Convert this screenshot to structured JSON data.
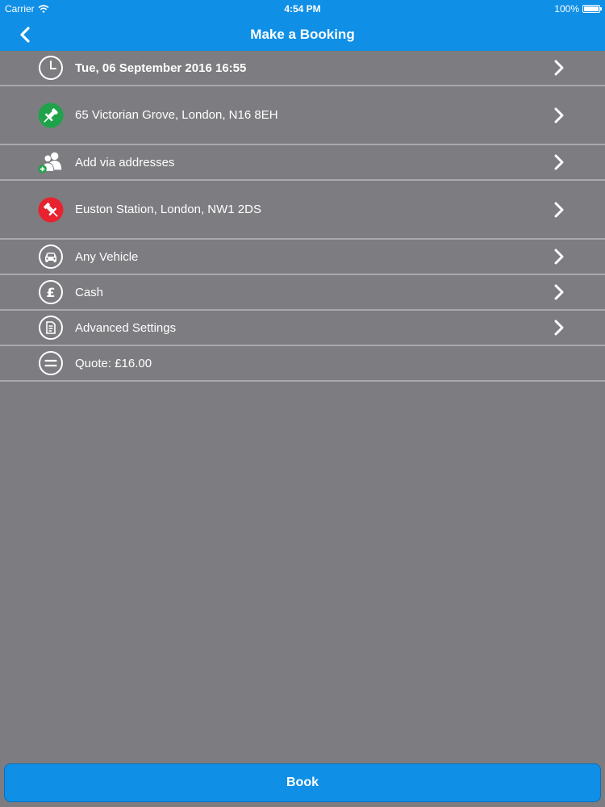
{
  "status_bar": {
    "carrier": "Carrier",
    "time": "4:54 PM",
    "battery": "100%"
  },
  "nav": {
    "title": "Make a Booking"
  },
  "rows": [
    {
      "label": "Tue, 06 September 2016 16:55",
      "icon": "clock-icon"
    },
    {
      "label": "65 Victorian Grove, London, N16 8EH",
      "icon": "pickup-pin-icon",
      "icon_color": "#1fa34a"
    },
    {
      "label": "Add via addresses",
      "icon": "add-people-icon",
      "icon_color": "#1fa34a"
    },
    {
      "label": "Euston Station, London, NW1 2DS",
      "icon": "dropoff-pin-icon",
      "icon_color": "#e8232f"
    },
    {
      "label": "Any Vehicle",
      "icon": "car-icon"
    },
    {
      "label": "Cash",
      "icon": "pound-icon"
    },
    {
      "label": "Advanced Settings",
      "icon": "document-settings-icon"
    },
    {
      "label": "Quote: £16.00",
      "icon": "quote-icon"
    }
  ],
  "book": {
    "label": "Book"
  },
  "colors": {
    "header": "#0f8fe6",
    "background": "#7d7c80",
    "divider": "#a9a8ac"
  }
}
